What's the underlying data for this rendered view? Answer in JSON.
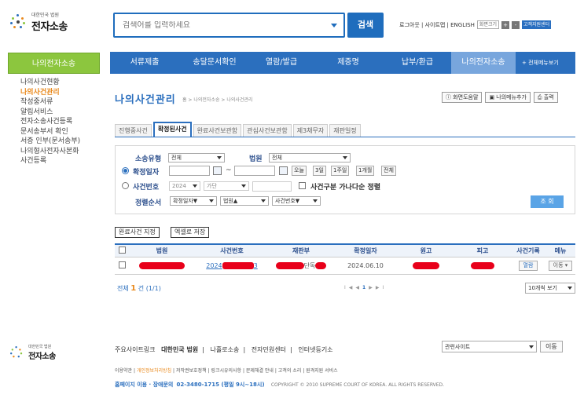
{
  "header": {
    "logo_small": "대한민국 법원",
    "logo_main": "전자소송",
    "search_placeholder": "검색어를 입력하세요",
    "search_button": "검색",
    "util_text": "로그아웃 | 사이트맵 | ENGLISH",
    "util_chip": "화면크기",
    "util_plus": "+",
    "util_minus": "-",
    "util_remote": "고객지원센터"
  },
  "sidebar": {
    "title": "나의전자소송",
    "items": [
      {
        "label": "나의사건현황",
        "active": false
      },
      {
        "label": "나의사건관리",
        "active": true
      },
      {
        "label": "작성중서류",
        "active": false
      },
      {
        "label": "알림서비스",
        "active": false
      },
      {
        "label": "전자소송사건등록",
        "active": false
      },
      {
        "label": "문서송부서 확인",
        "active": false
      },
      {
        "label": "서증 인부(문서송부)",
        "active": false
      },
      {
        "label": "나의형사전자사본화",
        "active": false
      },
      {
        "label": "사건등록",
        "active": false
      }
    ]
  },
  "nav": {
    "items": [
      "서류제출",
      "송달문서확인",
      "열람/발급",
      "제증명",
      "납부/환급",
      "나의전자소송"
    ],
    "active_index": 5,
    "all_menu": "+ 전체메뉴보기"
  },
  "page": {
    "title": "나의사건관리",
    "breadcrumb": "홈 > 나의전자소송 > 나의사건관리",
    "tools": [
      "화면도움말",
      "나의메뉴추가",
      "출력"
    ]
  },
  "tabs": [
    "진행중사건",
    "확정된사건",
    "완료사건보관함",
    "관심사건보관함",
    "제3채무자",
    "재판일정"
  ],
  "active_tab": 1,
  "filter": {
    "type_label": "소송유형",
    "type_value": "전체",
    "court_label": "법원",
    "court_value": "전체",
    "date_label": "확정일자",
    "tilde": "~",
    "date_buttons": [
      "오늘",
      "3일",
      "1주일",
      "1개월",
      "전체"
    ],
    "case_label": "사건번호",
    "year_value": "2024",
    "kind_value": "가단",
    "sort_check_label": "사건구분 가나다순 정렬",
    "order_label": "정렬순서",
    "order_1": "확정일자▼",
    "order_2": "법원▲",
    "order_3": "사건번호▼",
    "search_button": "조 회"
  },
  "actions": {
    "keep_button": "완료사건 지정",
    "excel_button": "엑셀로 저장"
  },
  "table": {
    "columns": [
      "법원",
      "사건번호",
      "재판부",
      "확정일자",
      "원고",
      "피고",
      "사건기록",
      "메뉴"
    ],
    "rows": [
      {
        "case_prefix": "2024",
        "case_suffix": "3",
        "division_suffix": "단독",
        "date": "2024.06.10",
        "record_button": "열람",
        "menu_button": "이동"
      }
    ]
  },
  "pagination": {
    "total_prefix": "전체",
    "total_count": "1",
    "total_suffix": "건 (1/1)",
    "first": "I◀",
    "prev": "◀",
    "current": "1",
    "next": "▶",
    "last": "▶I",
    "per_page": "10개씩 보기"
  },
  "footer": {
    "logo_small": "대한민국 법원",
    "logo_main": "전자소송",
    "links_label": "주요사이트링크",
    "links": [
      "대한민국 법원",
      "나홀로소송",
      "전자민원센터",
      "인터넷등기소"
    ],
    "related_select": "관련사이트",
    "go_button": "이동",
    "line1_a": "이용약관 |",
    "line1_highlight": "개인정보처리방침",
    "line1_b": "| 저작권보호정책 | 링크시유의사항 | 문제해결 안내 | 고객의 소리 | 원격지원 서비스",
    "line2_contact": "홈페이지 이용 · 장애문의",
    "line2_phone": "02-3480-1715 (평일 9시~18시)",
    "line2_copyright": "COPYRIGHT © 2010 SUPREME COURT OF KOREA. ALL RIGHTS RESERVED."
  },
  "colors": {
    "primary": "#2b6fbe",
    "sidebar_green": "#8cc63e",
    "active_orange": "#e9891c",
    "redaction": "#e8001a",
    "nav_active": "#78a6dd"
  }
}
